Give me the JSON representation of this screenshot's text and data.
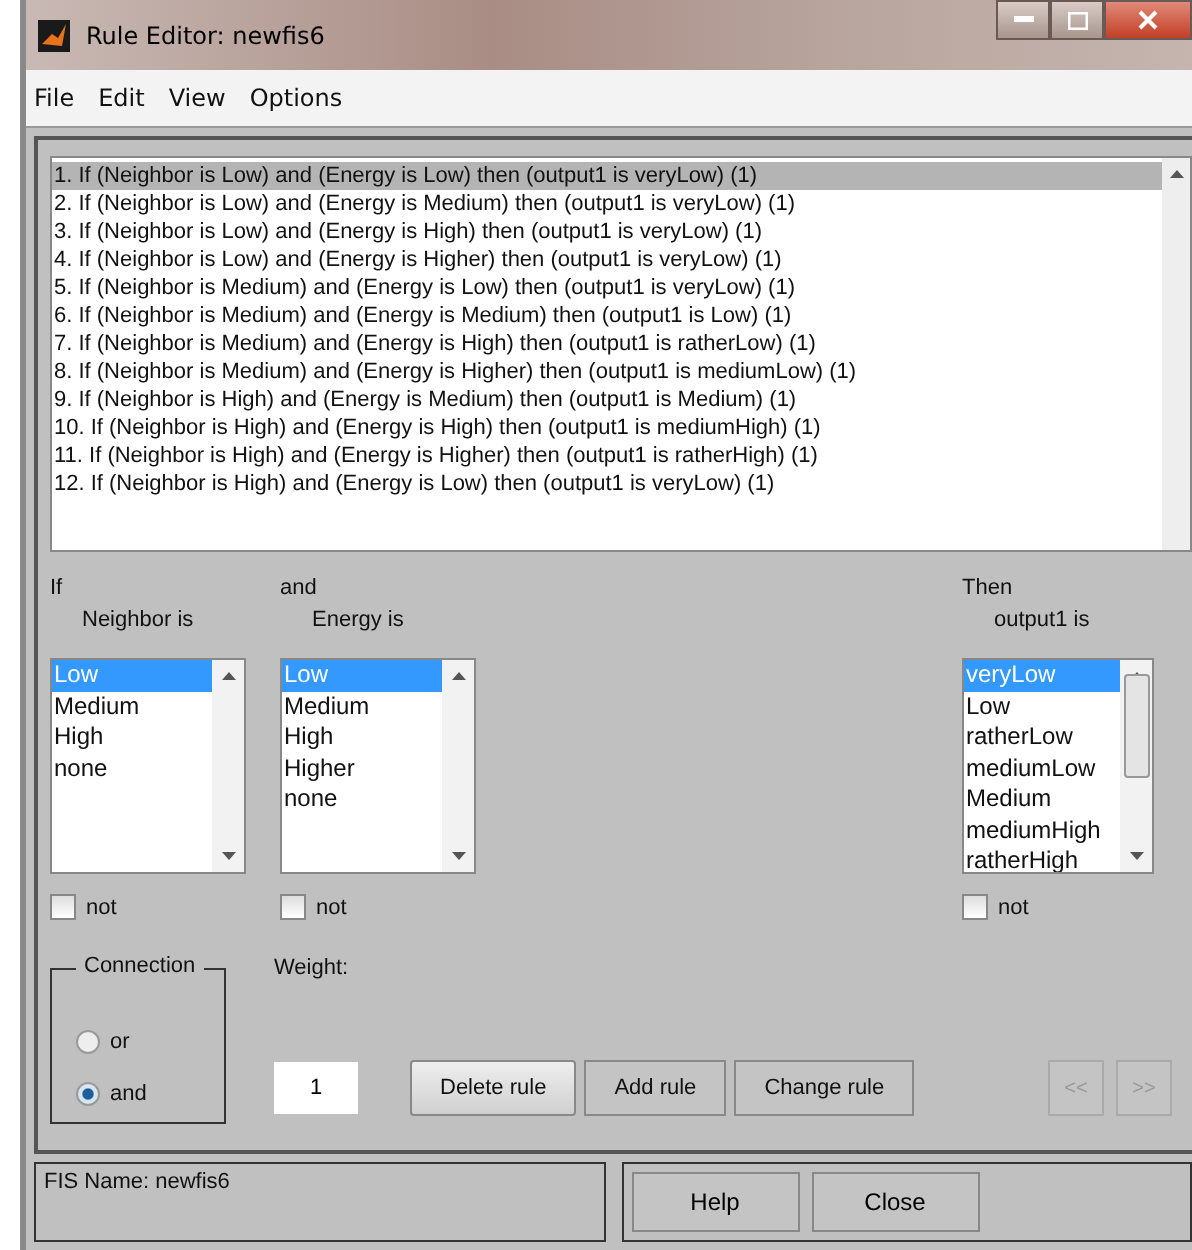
{
  "window": {
    "title": "Rule Editor: newfis6"
  },
  "menu": [
    "File",
    "Edit",
    "View",
    "Options"
  ],
  "rules": [
    {
      "text": "1. If (Neighbor is Low) and (Energy is Low) then (output1 is veryLow) (1)",
      "selected": true
    },
    {
      "text": "2. If (Neighbor is Low) and (Energy is Medium) then (output1 is veryLow) (1)",
      "selected": false
    },
    {
      "text": "3. If (Neighbor is Low) and (Energy is High) then (output1 is veryLow) (1)",
      "selected": false
    },
    {
      "text": "4. If (Neighbor is Low) and (Energy is Higher) then (output1 is veryLow) (1)",
      "selected": false
    },
    {
      "text": "5. If (Neighbor is Medium) and (Energy is Low) then (output1 is veryLow) (1)",
      "selected": false
    },
    {
      "text": "6. If (Neighbor is Medium) and (Energy is Medium) then (output1 is Low) (1)",
      "selected": false
    },
    {
      "text": "7. If (Neighbor is Medium) and (Energy is High) then (output1 is ratherLow) (1)",
      "selected": false
    },
    {
      "text": "8. If (Neighbor is Medium) and (Energy is Higher) then (output1 is mediumLow) (1)",
      "selected": false
    },
    {
      "text": "9. If (Neighbor is High) and (Energy is Medium) then (output1 is Medium) (1)",
      "selected": false
    },
    {
      "text": "10. If (Neighbor is High) and (Energy is High) then (output1 is mediumHigh) (1)",
      "selected": false
    },
    {
      "text": "11. If (Neighbor is High) and (Energy is Higher) then (output1 is ratherHigh) (1)",
      "selected": false
    },
    {
      "text": "12. If (Neighbor is High) and (Energy is Low) then (output1 is veryLow) (1)",
      "selected": false
    }
  ],
  "variables": [
    {
      "prefix": "If",
      "label": "Neighbor is",
      "not_label": "not",
      "not": false,
      "items": [
        {
          "text": "Low",
          "selected": true
        },
        {
          "text": "Medium",
          "selected": false
        },
        {
          "text": "High",
          "selected": false
        },
        {
          "text": "none",
          "selected": false
        }
      ]
    },
    {
      "prefix": "and",
      "label": "Energy is",
      "not_label": "not",
      "not": false,
      "items": [
        {
          "text": "Low",
          "selected": true
        },
        {
          "text": "Medium",
          "selected": false
        },
        {
          "text": "High",
          "selected": false
        },
        {
          "text": "Higher",
          "selected": false
        },
        {
          "text": "none",
          "selected": false
        }
      ]
    }
  ],
  "output": {
    "prefix": "Then",
    "label": "output1 is",
    "not_label": "not",
    "not": false,
    "items": [
      {
        "text": "veryLow",
        "selected": true
      },
      {
        "text": "Low",
        "selected": false
      },
      {
        "text": "ratherLow",
        "selected": false
      },
      {
        "text": "mediumLow",
        "selected": false
      },
      {
        "text": "Medium",
        "selected": false
      },
      {
        "text": "mediumHigh",
        "selected": false
      },
      {
        "text": "ratherHigh",
        "selected": false
      }
    ]
  },
  "connection": {
    "title": "Connection",
    "options": [
      {
        "label": "or",
        "selected": false
      },
      {
        "label": "and",
        "selected": true
      }
    ]
  },
  "weight": {
    "label": "Weight:",
    "value": "1"
  },
  "buttons": [
    {
      "label": "Delete rule",
      "disabled": false
    },
    {
      "label": "Add rule",
      "disabled": false
    },
    {
      "label": "Change rule",
      "disabled": false
    }
  ],
  "nav_buttons": [
    {
      "label": "<<",
      "disabled": true
    },
    {
      "label": ">>",
      "disabled": true
    }
  ],
  "status": "FIS Name: newfis6",
  "footer_buttons": [
    "Help",
    "Close"
  ]
}
